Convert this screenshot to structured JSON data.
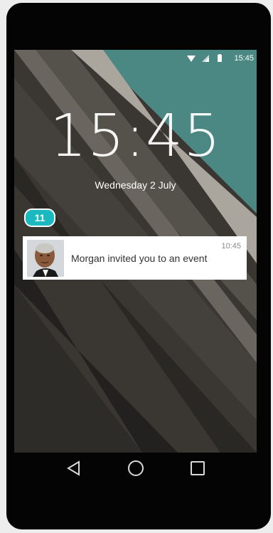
{
  "status_bar": {
    "time": "15:45",
    "icons": [
      "wifi-icon",
      "signal-icon",
      "battery-icon"
    ]
  },
  "lockscreen": {
    "clock": "15:45",
    "date": "Wednesday 2 July"
  },
  "badge": {
    "count": "11",
    "color": "#19b9bf"
  },
  "notification": {
    "message": "Morgan invited you to an event",
    "time": "10:45",
    "avatar": "avatar-photo"
  },
  "nav_bar": {
    "buttons": [
      "back-icon",
      "home-icon",
      "recents-icon"
    ]
  },
  "colors": {
    "teal_wallpaper": "#4e8b88",
    "phone_frame": "#040404"
  }
}
